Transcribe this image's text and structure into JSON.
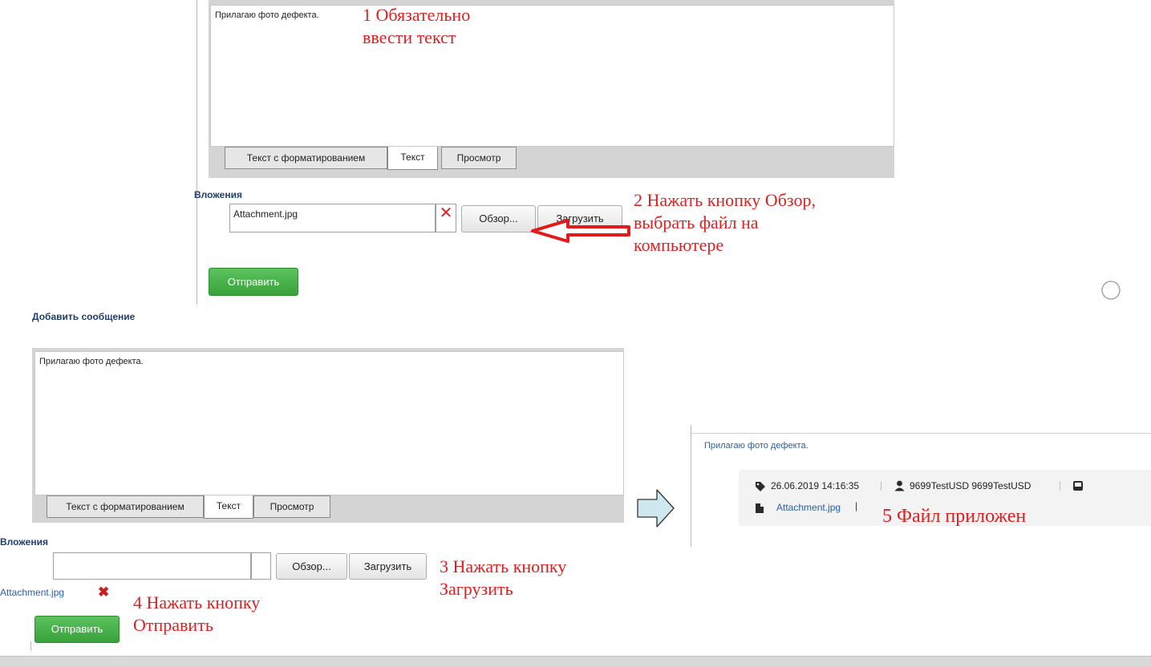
{
  "top_editor": {
    "text": "Прилагаю фото дефекта.",
    "tabs": [
      "Текст с форматированием",
      "Текст",
      "Просмотр"
    ],
    "attachments_label": "Вложения",
    "file_value": "Attachment.jpg",
    "browse_label": "Обзор...",
    "upload_label": "Загрузить",
    "submit_label": "Отправить"
  },
  "bottom_editor": {
    "title": "Добавить сообщение",
    "text": "Прилагаю фото дефекта.",
    "tabs": [
      "Текст с форматированием",
      "Текст",
      "Просмотр"
    ],
    "attachments_label": "Вложения",
    "file_value": "",
    "browse_label": "Обзор...",
    "upload_label": "Загрузить",
    "attached_file": "Attachment.jpg",
    "submit_label": "Отправить"
  },
  "result": {
    "message": "Прилагаю фото дефекта.",
    "datetime": "26.06.2019 14:16:35",
    "user": "9699TestUSD 9699TestUSD",
    "attachment": "Attachment.jpg"
  },
  "notes": {
    "step1_line1": "1 Обязательно",
    "step1_line2": "ввести текст",
    "step2_line1": "2 Нажать кнопку Обзор,",
    "step2_line2": "выбрать файл на",
    "step2_line3": "компьютере",
    "step3_line1": "3 Нажать кнопку",
    "step3_line2": "Загрузить",
    "step4_line1": "4 Нажать кнопку",
    "step4_line2": "Отправить",
    "step5": "5 Файл приложен"
  },
  "colors": {
    "note_red": "#e02020",
    "submit_green": "#3fa93f",
    "label_blue": "#1f3f6e",
    "link_blue": "#2a5ea8"
  }
}
